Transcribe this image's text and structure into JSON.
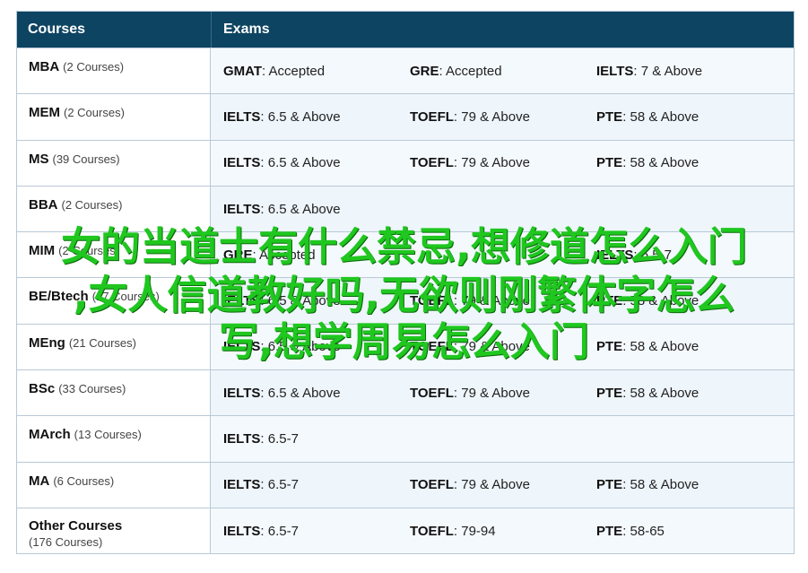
{
  "header": {
    "courses": "Courses",
    "exams": "Exams"
  },
  "rows": [
    {
      "name": "MBA",
      "count": "(2 Courses)",
      "exams": [
        {
          "name": "GMAT",
          "value": ": Accepted"
        },
        {
          "name": "GRE",
          "value": ": Accepted"
        },
        {
          "name": "IELTS",
          "value": ": 7 & Above"
        }
      ]
    },
    {
      "name": "MEM",
      "count": "(2 Courses)",
      "exams": [
        {
          "name": "IELTS",
          "value": ": 6.5 & Above"
        },
        {
          "name": "TOEFL",
          "value": ": 79 & Above"
        },
        {
          "name": "PTE",
          "value": ": 58 & Above"
        }
      ]
    },
    {
      "name": "MS",
      "count": "(39 Courses)",
      "exams": [
        {
          "name": "IELTS",
          "value": ": 6.5 & Above"
        },
        {
          "name": "TOEFL",
          "value": ": 79 & Above"
        },
        {
          "name": "PTE",
          "value": ": 58 & Above"
        }
      ]
    },
    {
      "name": "BBA",
      "count": "(2 Courses)",
      "exams": [
        {
          "name": "IELTS",
          "value": ": 6.5 & Above"
        }
      ]
    },
    {
      "name": "MIM",
      "count": "(2 Courses)",
      "exams": [
        {
          "name": "GRE",
          "value": ": Accepted"
        },
        {
          "name": "",
          "value": ""
        },
        {
          "name": "IELTS",
          "value": ": 6.5-7"
        }
      ]
    },
    {
      "name": "BE/Btech",
      "count": "(17 Courses)",
      "exams": [
        {
          "name": "IELTS",
          "value": ": 6.5 & Above"
        },
        {
          "name": "TOEFL",
          "value": ": 79 & Above"
        },
        {
          "name": "PTE",
          "value": ": 58 & Above"
        }
      ]
    },
    {
      "name": "MEng",
      "count": "(21 Courses)",
      "exams": [
        {
          "name": "IELTS",
          "value": ": 6.5 & Above"
        },
        {
          "name": "TOEFL",
          "value": ": 79 & Above"
        },
        {
          "name": "PTE",
          "value": ": 58 & Above"
        }
      ]
    },
    {
      "name": "BSc",
      "count": "(33 Courses)",
      "exams": [
        {
          "name": "IELTS",
          "value": ": 6.5 & Above"
        },
        {
          "name": "TOEFL",
          "value": ": 79 & Above"
        },
        {
          "name": "PTE",
          "value": ": 58 & Above"
        }
      ]
    },
    {
      "name": "MArch",
      "count": "(13 Courses)",
      "exams": [
        {
          "name": "IELTS",
          "value": ": 6.5-7"
        }
      ]
    },
    {
      "name": "MA",
      "count": "(6 Courses)",
      "exams": [
        {
          "name": "IELTS",
          "value": ": 6.5-7"
        },
        {
          "name": "TOEFL",
          "value": ": 79 & Above"
        },
        {
          "name": "PTE",
          "value": ": 58 & Above"
        }
      ]
    },
    {
      "name": "Other Courses",
      "count": "(176 Courses)",
      "multiline": true,
      "exams": [
        {
          "name": "IELTS",
          "value": ": 6.5-7"
        },
        {
          "name": "TOEFL",
          "value": ": 79-94"
        },
        {
          "name": "PTE",
          "value": ": 58-65"
        }
      ]
    }
  ],
  "overlay": {
    "line1": "女的当道士有什么禁忌,想修道怎么入门",
    "line2": ",女人信道教好吗,无欲则刚繁体字怎么",
    "line3": "写,想学周易怎么入门"
  }
}
